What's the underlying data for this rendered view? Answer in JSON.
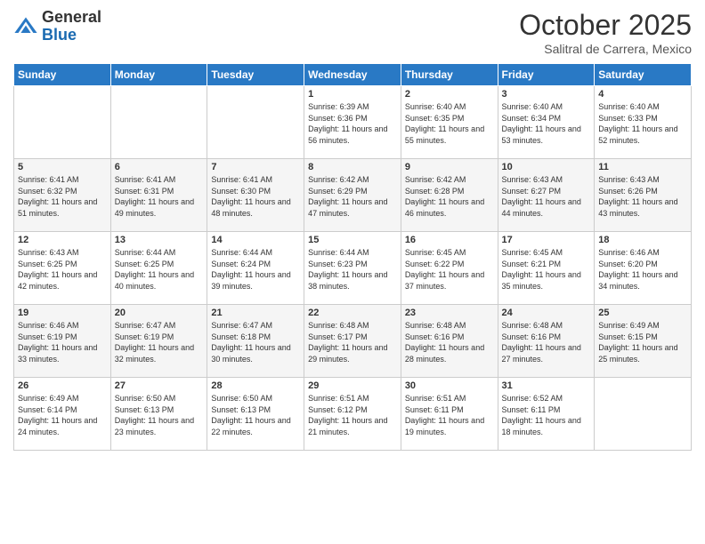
{
  "header": {
    "logo": {
      "general": "General",
      "blue": "Blue"
    },
    "title": "October 2025",
    "location": "Salitral de Carrera, Mexico"
  },
  "weekdays": [
    "Sunday",
    "Monday",
    "Tuesday",
    "Wednesday",
    "Thursday",
    "Friday",
    "Saturday"
  ],
  "weeks": [
    [
      {
        "day": "",
        "sunrise": "",
        "sunset": "",
        "daylight": ""
      },
      {
        "day": "",
        "sunrise": "",
        "sunset": "",
        "daylight": ""
      },
      {
        "day": "",
        "sunrise": "",
        "sunset": "",
        "daylight": ""
      },
      {
        "day": "1",
        "sunrise": "Sunrise: 6:39 AM",
        "sunset": "Sunset: 6:36 PM",
        "daylight": "Daylight: 11 hours and 56 minutes."
      },
      {
        "day": "2",
        "sunrise": "Sunrise: 6:40 AM",
        "sunset": "Sunset: 6:35 PM",
        "daylight": "Daylight: 11 hours and 55 minutes."
      },
      {
        "day": "3",
        "sunrise": "Sunrise: 6:40 AM",
        "sunset": "Sunset: 6:34 PM",
        "daylight": "Daylight: 11 hours and 53 minutes."
      },
      {
        "day": "4",
        "sunrise": "Sunrise: 6:40 AM",
        "sunset": "Sunset: 6:33 PM",
        "daylight": "Daylight: 11 hours and 52 minutes."
      }
    ],
    [
      {
        "day": "5",
        "sunrise": "Sunrise: 6:41 AM",
        "sunset": "Sunset: 6:32 PM",
        "daylight": "Daylight: 11 hours and 51 minutes."
      },
      {
        "day": "6",
        "sunrise": "Sunrise: 6:41 AM",
        "sunset": "Sunset: 6:31 PM",
        "daylight": "Daylight: 11 hours and 49 minutes."
      },
      {
        "day": "7",
        "sunrise": "Sunrise: 6:41 AM",
        "sunset": "Sunset: 6:30 PM",
        "daylight": "Daylight: 11 hours and 48 minutes."
      },
      {
        "day": "8",
        "sunrise": "Sunrise: 6:42 AM",
        "sunset": "Sunset: 6:29 PM",
        "daylight": "Daylight: 11 hours and 47 minutes."
      },
      {
        "day": "9",
        "sunrise": "Sunrise: 6:42 AM",
        "sunset": "Sunset: 6:28 PM",
        "daylight": "Daylight: 11 hours and 46 minutes."
      },
      {
        "day": "10",
        "sunrise": "Sunrise: 6:43 AM",
        "sunset": "Sunset: 6:27 PM",
        "daylight": "Daylight: 11 hours and 44 minutes."
      },
      {
        "day": "11",
        "sunrise": "Sunrise: 6:43 AM",
        "sunset": "Sunset: 6:26 PM",
        "daylight": "Daylight: 11 hours and 43 minutes."
      }
    ],
    [
      {
        "day": "12",
        "sunrise": "Sunrise: 6:43 AM",
        "sunset": "Sunset: 6:25 PM",
        "daylight": "Daylight: 11 hours and 42 minutes."
      },
      {
        "day": "13",
        "sunrise": "Sunrise: 6:44 AM",
        "sunset": "Sunset: 6:25 PM",
        "daylight": "Daylight: 11 hours and 40 minutes."
      },
      {
        "day": "14",
        "sunrise": "Sunrise: 6:44 AM",
        "sunset": "Sunset: 6:24 PM",
        "daylight": "Daylight: 11 hours and 39 minutes."
      },
      {
        "day": "15",
        "sunrise": "Sunrise: 6:44 AM",
        "sunset": "Sunset: 6:23 PM",
        "daylight": "Daylight: 11 hours and 38 minutes."
      },
      {
        "day": "16",
        "sunrise": "Sunrise: 6:45 AM",
        "sunset": "Sunset: 6:22 PM",
        "daylight": "Daylight: 11 hours and 37 minutes."
      },
      {
        "day": "17",
        "sunrise": "Sunrise: 6:45 AM",
        "sunset": "Sunset: 6:21 PM",
        "daylight": "Daylight: 11 hours and 35 minutes."
      },
      {
        "day": "18",
        "sunrise": "Sunrise: 6:46 AM",
        "sunset": "Sunset: 6:20 PM",
        "daylight": "Daylight: 11 hours and 34 minutes."
      }
    ],
    [
      {
        "day": "19",
        "sunrise": "Sunrise: 6:46 AM",
        "sunset": "Sunset: 6:19 PM",
        "daylight": "Daylight: 11 hours and 33 minutes."
      },
      {
        "day": "20",
        "sunrise": "Sunrise: 6:47 AM",
        "sunset": "Sunset: 6:19 PM",
        "daylight": "Daylight: 11 hours and 32 minutes."
      },
      {
        "day": "21",
        "sunrise": "Sunrise: 6:47 AM",
        "sunset": "Sunset: 6:18 PM",
        "daylight": "Daylight: 11 hours and 30 minutes."
      },
      {
        "day": "22",
        "sunrise": "Sunrise: 6:48 AM",
        "sunset": "Sunset: 6:17 PM",
        "daylight": "Daylight: 11 hours and 29 minutes."
      },
      {
        "day": "23",
        "sunrise": "Sunrise: 6:48 AM",
        "sunset": "Sunset: 6:16 PM",
        "daylight": "Daylight: 11 hours and 28 minutes."
      },
      {
        "day": "24",
        "sunrise": "Sunrise: 6:48 AM",
        "sunset": "Sunset: 6:16 PM",
        "daylight": "Daylight: 11 hours and 27 minutes."
      },
      {
        "day": "25",
        "sunrise": "Sunrise: 6:49 AM",
        "sunset": "Sunset: 6:15 PM",
        "daylight": "Daylight: 11 hours and 25 minutes."
      }
    ],
    [
      {
        "day": "26",
        "sunrise": "Sunrise: 6:49 AM",
        "sunset": "Sunset: 6:14 PM",
        "daylight": "Daylight: 11 hours and 24 minutes."
      },
      {
        "day": "27",
        "sunrise": "Sunrise: 6:50 AM",
        "sunset": "Sunset: 6:13 PM",
        "daylight": "Daylight: 11 hours and 23 minutes."
      },
      {
        "day": "28",
        "sunrise": "Sunrise: 6:50 AM",
        "sunset": "Sunset: 6:13 PM",
        "daylight": "Daylight: 11 hours and 22 minutes."
      },
      {
        "day": "29",
        "sunrise": "Sunrise: 6:51 AM",
        "sunset": "Sunset: 6:12 PM",
        "daylight": "Daylight: 11 hours and 21 minutes."
      },
      {
        "day": "30",
        "sunrise": "Sunrise: 6:51 AM",
        "sunset": "Sunset: 6:11 PM",
        "daylight": "Daylight: 11 hours and 19 minutes."
      },
      {
        "day": "31",
        "sunrise": "Sunrise: 6:52 AM",
        "sunset": "Sunset: 6:11 PM",
        "daylight": "Daylight: 11 hours and 18 minutes."
      },
      {
        "day": "",
        "sunrise": "",
        "sunset": "",
        "daylight": ""
      }
    ]
  ]
}
